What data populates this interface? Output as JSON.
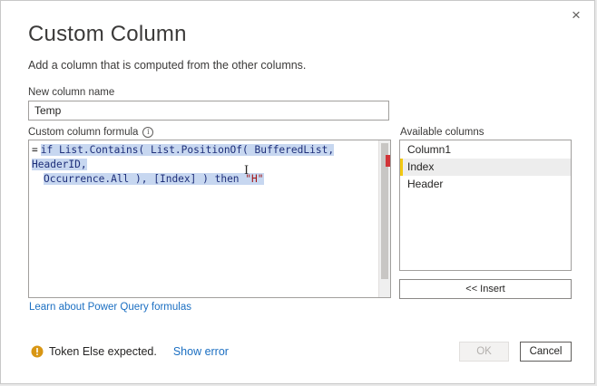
{
  "dialog": {
    "title": "Custom Column",
    "subtitle": "Add a column that is computed from the other columns.",
    "close_icon": "×"
  },
  "new_column": {
    "label": "New column name",
    "value": "Temp"
  },
  "formula": {
    "label": "Custom column formula",
    "info_icon": "i",
    "eq": "=",
    "line1": "if List.Contains( List.PositionOf( BufferedList, HeaderID,",
    "line2_prefix": "Occurrence.All ), [Index] ) then ",
    "line2_string": "\"H\""
  },
  "available_columns": {
    "label": "Available columns",
    "items": [
      "Column1",
      "Index",
      "Header"
    ],
    "selected": "Index",
    "insert_label": "<< Insert"
  },
  "learn_link": "Learn about Power Query formulas",
  "status": {
    "message": "Token Else expected.",
    "show_error": "Show error"
  },
  "buttons": {
    "ok": "OK",
    "cancel": "Cancel"
  },
  "colors": {
    "accent_selected": "#f2c811",
    "link": "#1b6fc2",
    "warning": "#d89614",
    "error_marker": "#d13438"
  }
}
